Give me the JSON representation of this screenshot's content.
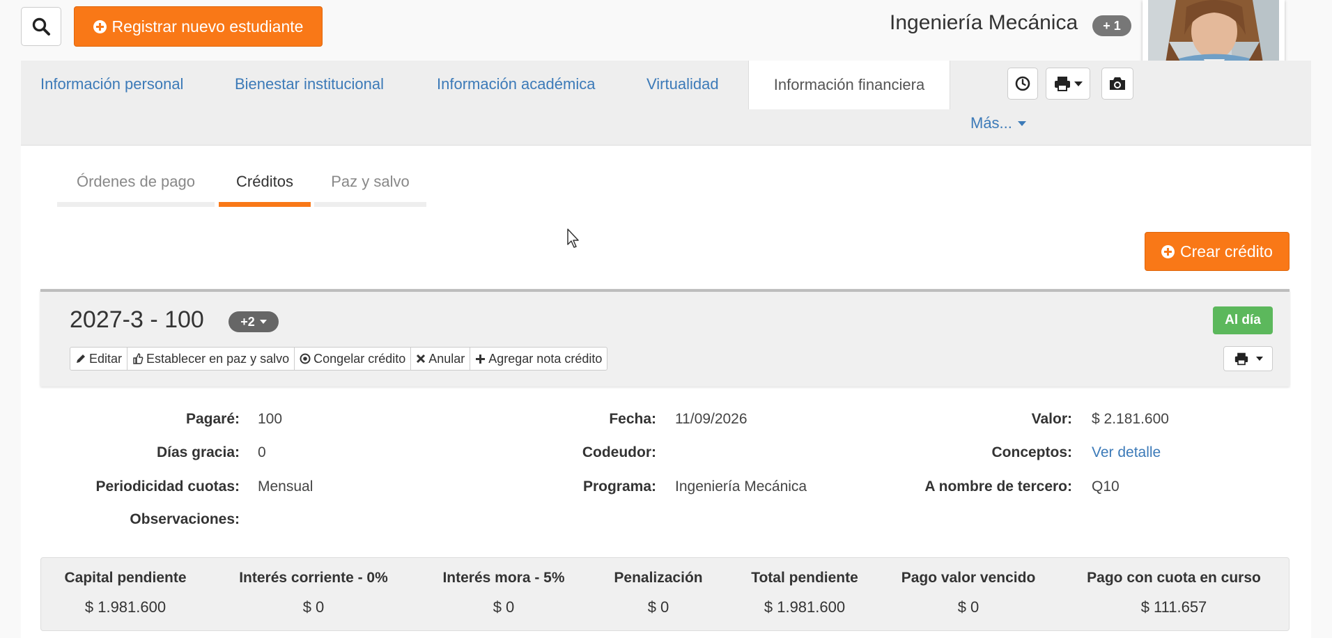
{
  "topbar": {
    "register_label": "Registrar nuevo estudiante",
    "program_name": "Ingeniería Mecánica",
    "program_badge": "+ 1"
  },
  "main_tabs": [
    {
      "label": "Información personal"
    },
    {
      "label": "Bienestar institucional"
    },
    {
      "label": "Información académica"
    },
    {
      "label": "Virtualidad"
    },
    {
      "label": "Información financiera"
    }
  ],
  "main_tabs_active": "Información financiera",
  "more_label": "Más...",
  "sub_tabs": [
    {
      "label": "Órdenes de pago"
    },
    {
      "label": "Créditos"
    },
    {
      "label": "Paz y salvo"
    }
  ],
  "sub_tabs_active": "Créditos",
  "create_credit_label": "Crear crédito",
  "credit": {
    "title": "2027-3 - 100",
    "badge": "+2",
    "status": "Al día",
    "actions": [
      {
        "label": "Editar"
      },
      {
        "label": "Establecer en paz y salvo"
      },
      {
        "label": "Congelar crédito"
      },
      {
        "label": "Anular"
      },
      {
        "label": "Agregar nota crédito"
      }
    ]
  },
  "details": {
    "col1": [
      {
        "label": "Pagaré:",
        "value": "100"
      },
      {
        "label": "Días gracia:",
        "value": "0"
      },
      {
        "label": "Periodicidad cuotas:",
        "value": "Mensual"
      },
      {
        "label": "Observaciones:",
        "value": ""
      }
    ],
    "col2": [
      {
        "label": "Fecha:",
        "value": "11/09/2026"
      },
      {
        "label": "Codeudor:",
        "value": ""
      },
      {
        "label": "Programa:",
        "value": "Ingeniería Mecánica"
      }
    ],
    "col3": [
      {
        "label": "Valor:",
        "value": "$ 2.181.600"
      },
      {
        "label": "Conceptos:",
        "value": "Ver detalle"
      },
      {
        "label": "A nombre de tercero:",
        "value": "Q10"
      }
    ]
  },
  "summary": [
    {
      "label": "Capital pendiente",
      "value": "$ 1.981.600"
    },
    {
      "label": "Interés corriente - 0%",
      "value": "$ 0"
    },
    {
      "label": "Interés mora - 5%",
      "value": "$ 0"
    },
    {
      "label": "Penalización",
      "value": "$ 0"
    },
    {
      "label": "Total pendiente",
      "value": "$ 1.981.600"
    },
    {
      "label": "Pago valor vencido",
      "value": "$ 0"
    },
    {
      "label": "Pago con cuota en curso",
      "value": "$ 111.657"
    }
  ],
  "colors": {
    "accent": "#f97817",
    "link": "#3c7ab8",
    "success": "#5cb85c"
  }
}
